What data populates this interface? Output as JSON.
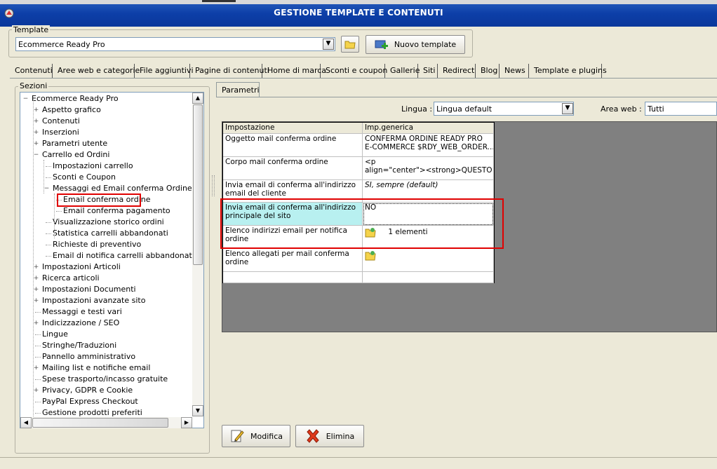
{
  "window": {
    "title": "GESTIONE TEMPLATE E CONTENUTI"
  },
  "template_group": {
    "label": "Template",
    "selected": "Ecommerce Ready Pro",
    "new_button": "Nuovo template"
  },
  "tabs": [
    "Contenuti",
    "Aree web e categorie",
    "File aggiuntivi",
    "Pagine di contenuti",
    "Home di marca",
    "Sconti e coupon",
    "Gallerie",
    "Siti",
    "Redirect",
    "Blog",
    "News",
    "Template e plugins"
  ],
  "sections": {
    "label": "Sezioni",
    "tree": [
      {
        "label": "Ecommerce Ready Pro",
        "exp": "-"
      },
      {
        "label": "Aspetto grafico",
        "exp": "+"
      },
      {
        "label": "Contenuti",
        "exp": "+"
      },
      {
        "label": "Inserzioni",
        "exp": "+"
      },
      {
        "label": "Parametri utente",
        "exp": "+"
      },
      {
        "label": "Carrello ed Ordini",
        "exp": "-"
      },
      {
        "label": "Impostazioni carrello",
        "exp": ""
      },
      {
        "label": "Sconti e Coupon",
        "exp": ""
      },
      {
        "label": "Messaggi ed Email conferma Ordine",
        "exp": "-"
      },
      {
        "label": "Email conferma ordine",
        "exp": ""
      },
      {
        "label": "Email conferma pagamento",
        "exp": ""
      },
      {
        "label": "Visualizzazione storico ordini",
        "exp": ""
      },
      {
        "label": "Statistica carrelli abbandonati",
        "exp": ""
      },
      {
        "label": "Richieste di preventivo",
        "exp": ""
      },
      {
        "label": "Email di notifica carrelli abbandonati",
        "exp": ""
      },
      {
        "label": "Impostazioni Articoli",
        "exp": "+"
      },
      {
        "label": "Ricerca articoli",
        "exp": "+"
      },
      {
        "label": "Impostazioni Documenti",
        "exp": "+"
      },
      {
        "label": "Impostazioni avanzate sito",
        "exp": "+"
      },
      {
        "label": "Messaggi e testi vari",
        "exp": ""
      },
      {
        "label": "Indicizzazione / SEO",
        "exp": "+"
      },
      {
        "label": "Lingue",
        "exp": ""
      },
      {
        "label": "Stringhe/Traduzioni",
        "exp": ""
      },
      {
        "label": "Pannello amministrativo",
        "exp": ""
      },
      {
        "label": "Mailing list e notifiche email",
        "exp": "+"
      },
      {
        "label": "Spese trasporto/incasso gratuite",
        "exp": ""
      },
      {
        "label": "Privacy, GDPR e Cookie",
        "exp": "+"
      },
      {
        "label": "PayPal Express Checkout",
        "exp": ""
      },
      {
        "label": "Gestione prodotti preferiti",
        "exp": ""
      }
    ]
  },
  "params": {
    "tab": "Parametri",
    "lingua_label": "Lingua :",
    "lingua_value": "Lingua default",
    "area_label": "Area web :",
    "area_value": "Tutti",
    "columns": [
      "Impostazione",
      "Imp.generica"
    ],
    "rows": [
      {
        "name": "Oggetto mail conferma ordine",
        "value": "CONFERMA ORDINE READY PRO\nE-COMMERCE $RDY_WEB_ORDER..."
      },
      {
        "name": "Corpo mail conferma ordine",
        "value": "<p\nalign=\"center\"><strong>QUESTO E'"
      },
      {
        "name": "Invia email di conferma all'indirizzo email del cliente",
        "value": "SI, sempre (default)"
      },
      {
        "name": "Invia email di conferma all'indirizzo principale del sito",
        "value": "NO"
      },
      {
        "name": "Elenco indirizzi email per notifica ordine",
        "value": "1 elementi"
      },
      {
        "name": "Elenco allegati per mail conferma ordine",
        "value": ""
      }
    ],
    "modifica": "Modifica",
    "elimina": "Elimina"
  },
  "colors": {
    "highlight_red": "#e00000",
    "selected_cell": "#b8f0f0",
    "title_blue": "#0d3fa8"
  }
}
